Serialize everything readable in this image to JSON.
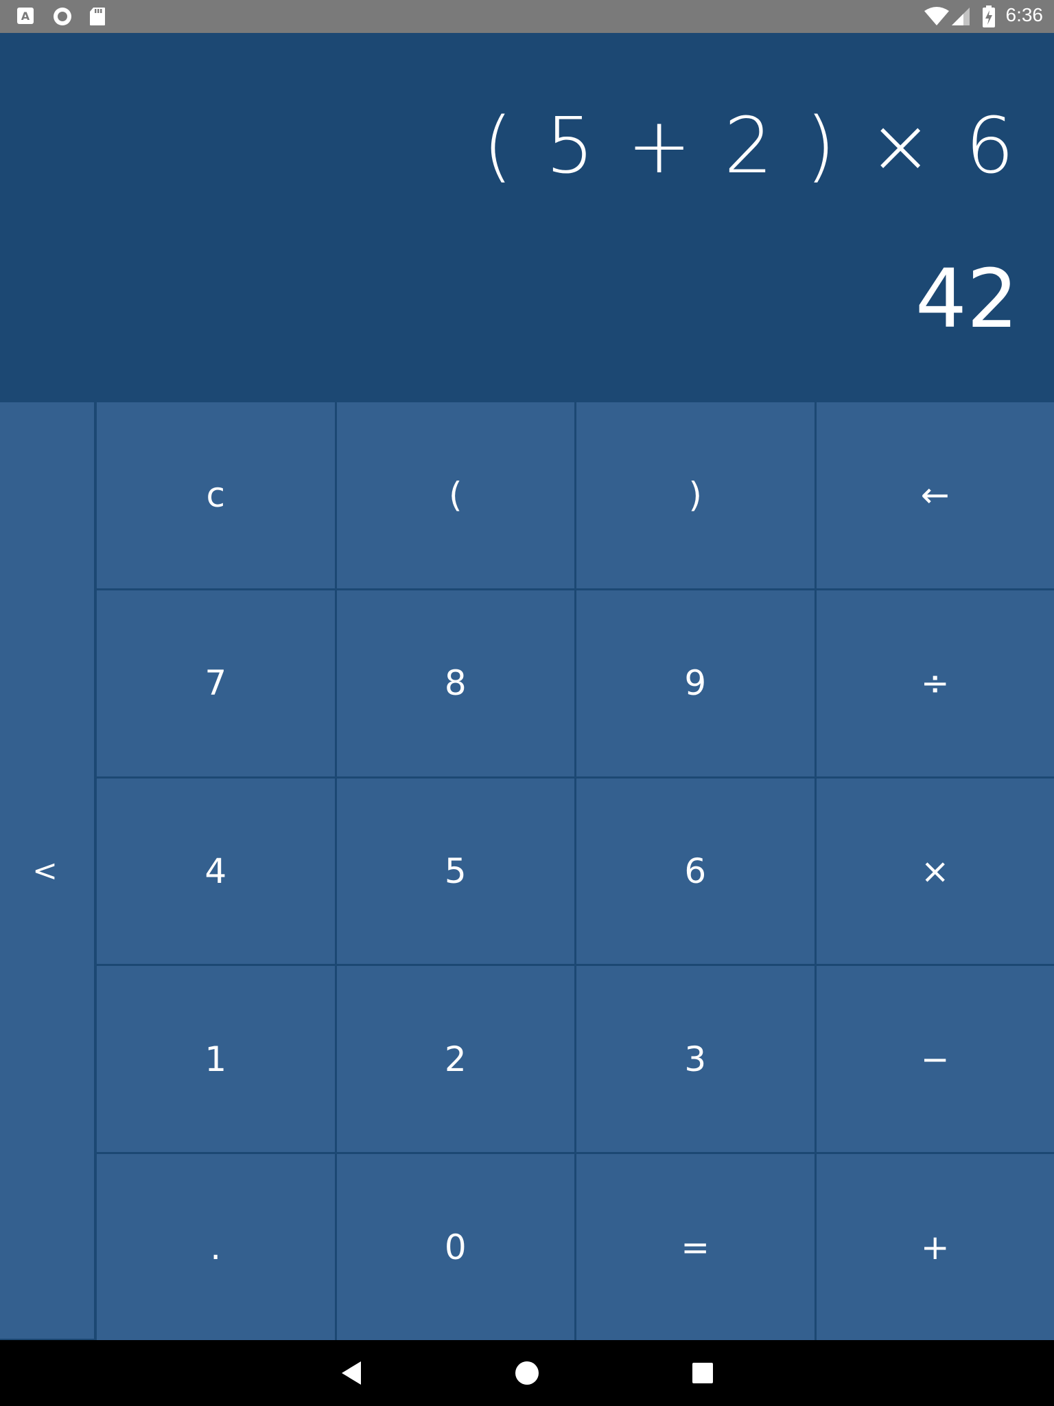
{
  "status_bar": {
    "time": "6:36",
    "left_icons": [
      "keyboard-icon",
      "record-icon",
      "sd-card-icon"
    ],
    "right_icons": [
      "wifi-icon",
      "signal-icon",
      "battery-charging-icon"
    ]
  },
  "display": {
    "expression": "( 5 + 2 ) × 6",
    "result": "42"
  },
  "keypad": {
    "side_tab_label": "<",
    "keys": [
      "c",
      "(",
      ")",
      "←",
      "7",
      "8",
      "9",
      "÷",
      "4",
      "5",
      "6",
      "×",
      "1",
      "2",
      "3",
      "−",
      ".",
      "0",
      "=",
      "+"
    ]
  },
  "nav_bar": {
    "buttons": [
      "back-icon",
      "home-icon",
      "recents-icon"
    ]
  },
  "colors": {
    "display_bg": "#1c4873",
    "key_bg": "#34608f",
    "status_bar_bg": "#7a7a7a"
  }
}
